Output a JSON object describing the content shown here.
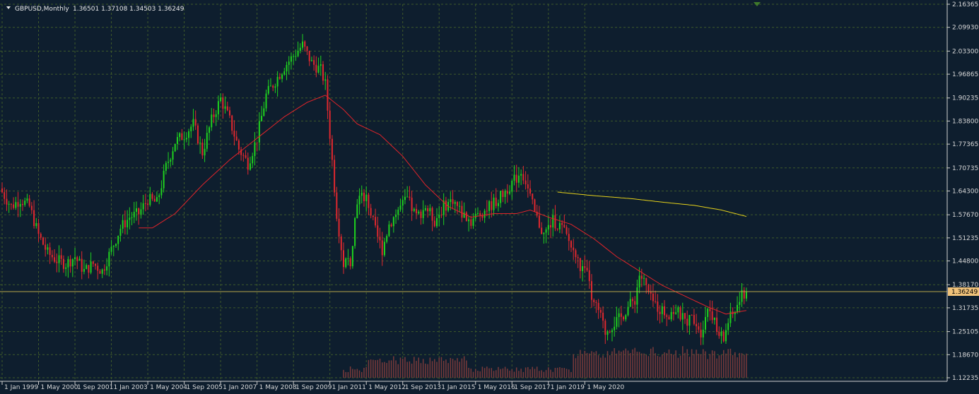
{
  "header": {
    "symbol": "GBPUSD,Monthly",
    "ohlc": "1.36501 1.37108 1.34503 1.36249"
  },
  "current_price_label": "1.36249",
  "colors": {
    "background": "#0e1e2e",
    "grid": "#3f5a2a",
    "axis": "#d0d0d0",
    "bull": "#1fd21f",
    "bear": "#e0282e",
    "ma_short": "#e0242a",
    "ma_long": "#e6d21a",
    "volume": "#7a3a3a",
    "price_line": "#b8a64a",
    "price_box": "#f0c27a"
  },
  "chart_data": {
    "type": "candlestick",
    "y_ticks": [
      "2.16365",
      "2.09930",
      "2.03300",
      "1.96865",
      "1.90235",
      "1.83800",
      "1.77365",
      "1.70735",
      "1.64300",
      "1.57670",
      "1.51235",
      "1.44800",
      "1.38170",
      "1.31735",
      "1.25105",
      "1.18670",
      "1.12235"
    ],
    "x_ticks": [
      "1 Jan 1999",
      "1 May 2000",
      "1 Sep 2001",
      "1 Jan 2003",
      "1 May 2004",
      "1 Sep 2005",
      "1 Jan 2007",
      "1 May 2008",
      "1 Sep 2009",
      "1 Jan 2011",
      "1 May 2012",
      "1 Sep 2013",
      "1 Jan 2015",
      "1 May 2016",
      "1 Sep 2017",
      "1 Jan 2019",
      "1 May 2020"
    ],
    "ylim": [
      1.12235,
      2.16365
    ],
    "current_price": 1.36249,
    "close_anchors": [
      [
        0,
        1.64
      ],
      [
        4,
        1.6
      ],
      [
        8,
        1.62
      ],
      [
        12,
        1.6
      ],
      [
        16,
        1.52
      ],
      [
        20,
        1.47
      ],
      [
        24,
        1.45
      ],
      [
        28,
        1.44
      ],
      [
        32,
        1.46
      ],
      [
        36,
        1.42
      ],
      [
        40,
        1.44
      ],
      [
        44,
        1.42
      ],
      [
        48,
        1.48
      ],
      [
        52,
        1.54
      ],
      [
        56,
        1.57
      ],
      [
        60,
        1.58
      ],
      [
        64,
        1.62
      ],
      [
        68,
        1.61
      ],
      [
        72,
        1.71
      ],
      [
        76,
        1.78
      ],
      [
        80,
        1.8
      ],
      [
        84,
        1.83
      ],
      [
        88,
        1.75
      ],
      [
        92,
        1.84
      ],
      [
        96,
        1.9
      ],
      [
        100,
        1.84
      ],
      [
        104,
        1.76
      ],
      [
        108,
        1.72
      ],
      [
        112,
        1.79
      ],
      [
        116,
        1.91
      ],
      [
        120,
        1.95
      ],
      [
        124,
        1.99
      ],
      [
        128,
        2.02
      ],
      [
        132,
        2.05
      ],
      [
        136,
        2.0
      ],
      [
        140,
        1.98
      ],
      [
        142,
        1.94
      ],
      [
        144,
        1.8
      ],
      [
        147,
        1.58
      ],
      [
        150,
        1.44
      ],
      [
        153,
        1.45
      ],
      [
        156,
        1.62
      ],
      [
        160,
        1.63
      ],
      [
        164,
        1.53
      ],
      [
        167,
        1.48
      ],
      [
        170,
        1.55
      ],
      [
        174,
        1.59
      ],
      [
        178,
        1.62
      ],
      [
        182,
        1.57
      ],
      [
        186,
        1.6
      ],
      [
        190,
        1.56
      ],
      [
        194,
        1.6
      ],
      [
        198,
        1.62
      ],
      [
        202,
        1.58
      ],
      [
        206,
        1.56
      ],
      [
        210,
        1.58
      ],
      [
        214,
        1.6
      ],
      [
        218,
        1.62
      ],
      [
        222,
        1.65
      ],
      [
        226,
        1.68
      ],
      [
        228,
        1.7
      ],
      [
        230,
        1.67
      ],
      [
        234,
        1.58
      ],
      [
        238,
        1.52
      ],
      [
        242,
        1.56
      ],
      [
        246,
        1.54
      ],
      [
        250,
        1.49
      ],
      [
        254,
        1.43
      ],
      [
        258,
        1.4
      ],
      [
        259,
        1.33
      ],
      [
        262,
        1.31
      ],
      [
        265,
        1.25
      ],
      [
        268,
        1.27
      ],
      [
        272,
        1.29
      ],
      [
        275,
        1.32
      ],
      [
        278,
        1.34
      ],
      [
        280,
        1.41
      ],
      [
        282,
        1.39
      ],
      [
        285,
        1.34
      ],
      [
        288,
        1.32
      ],
      [
        292,
        1.3
      ],
      [
        296,
        1.31
      ],
      [
        300,
        1.28
      ],
      [
        304,
        1.29
      ],
      [
        307,
        1.25
      ],
      [
        310,
        1.32
      ],
      [
        312,
        1.3
      ],
      [
        314,
        1.25
      ],
      [
        317,
        1.23
      ],
      [
        319,
        1.28
      ],
      [
        322,
        1.31
      ],
      [
        325,
        1.35
      ],
      [
        327,
        1.36249
      ]
    ],
    "ma_short": {
      "start_index": 60,
      "anchors": [
        [
          60,
          1.54
        ],
        [
          66,
          1.54
        ],
        [
          76,
          1.58
        ],
        [
          88,
          1.66
        ],
        [
          100,
          1.73
        ],
        [
          112,
          1.79
        ],
        [
          124,
          1.85
        ],
        [
          134,
          1.89
        ],
        [
          142,
          1.91
        ],
        [
          150,
          1.87
        ],
        [
          156,
          1.83
        ],
        [
          166,
          1.8
        ],
        [
          176,
          1.74
        ],
        [
          186,
          1.66
        ],
        [
          196,
          1.6
        ],
        [
          206,
          1.57
        ],
        [
          216,
          1.58
        ],
        [
          226,
          1.58
        ],
        [
          232,
          1.59
        ],
        [
          240,
          1.57
        ],
        [
          250,
          1.55
        ],
        [
          260,
          1.51
        ],
        [
          270,
          1.46
        ],
        [
          280,
          1.42
        ],
        [
          290,
          1.38
        ],
        [
          300,
          1.35
        ],
        [
          310,
          1.32
        ],
        [
          318,
          1.3
        ],
        [
          327,
          1.31
        ]
      ]
    },
    "ma_long": {
      "start_index": 244,
      "anchors": [
        [
          244,
          1.64
        ],
        [
          260,
          1.63
        ],
        [
          276,
          1.622
        ],
        [
          290,
          1.612
        ],
        [
          304,
          1.603
        ],
        [
          316,
          1.59
        ],
        [
          327,
          1.572
        ]
      ]
    }
  }
}
